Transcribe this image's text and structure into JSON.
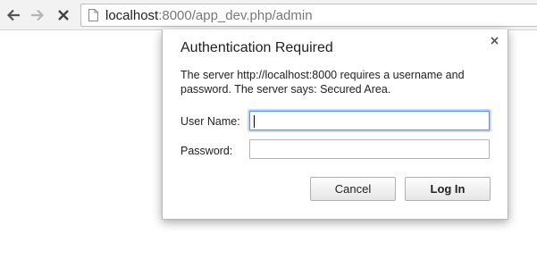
{
  "browser": {
    "url_host": "localhost",
    "url_rest": ":8000/app_dev.php/admin",
    "back_icon": "back-arrow-icon",
    "forward_icon": "forward-arrow-icon",
    "stop_icon": "stop-icon",
    "page_icon": "page-icon"
  },
  "dialog": {
    "title": "Authentication Required",
    "message": "The server http://localhost:8000 requires a username and password. The server says: Secured Area.",
    "username_label": "User Name:",
    "username_value": "",
    "password_label": "Password:",
    "password_value": "",
    "cancel_label": "Cancel",
    "login_label": "Log In",
    "close_icon": "close-icon"
  },
  "colors": {
    "focus_ring": "#4d90fe",
    "toolbar_bg": "#f2f2f2"
  }
}
